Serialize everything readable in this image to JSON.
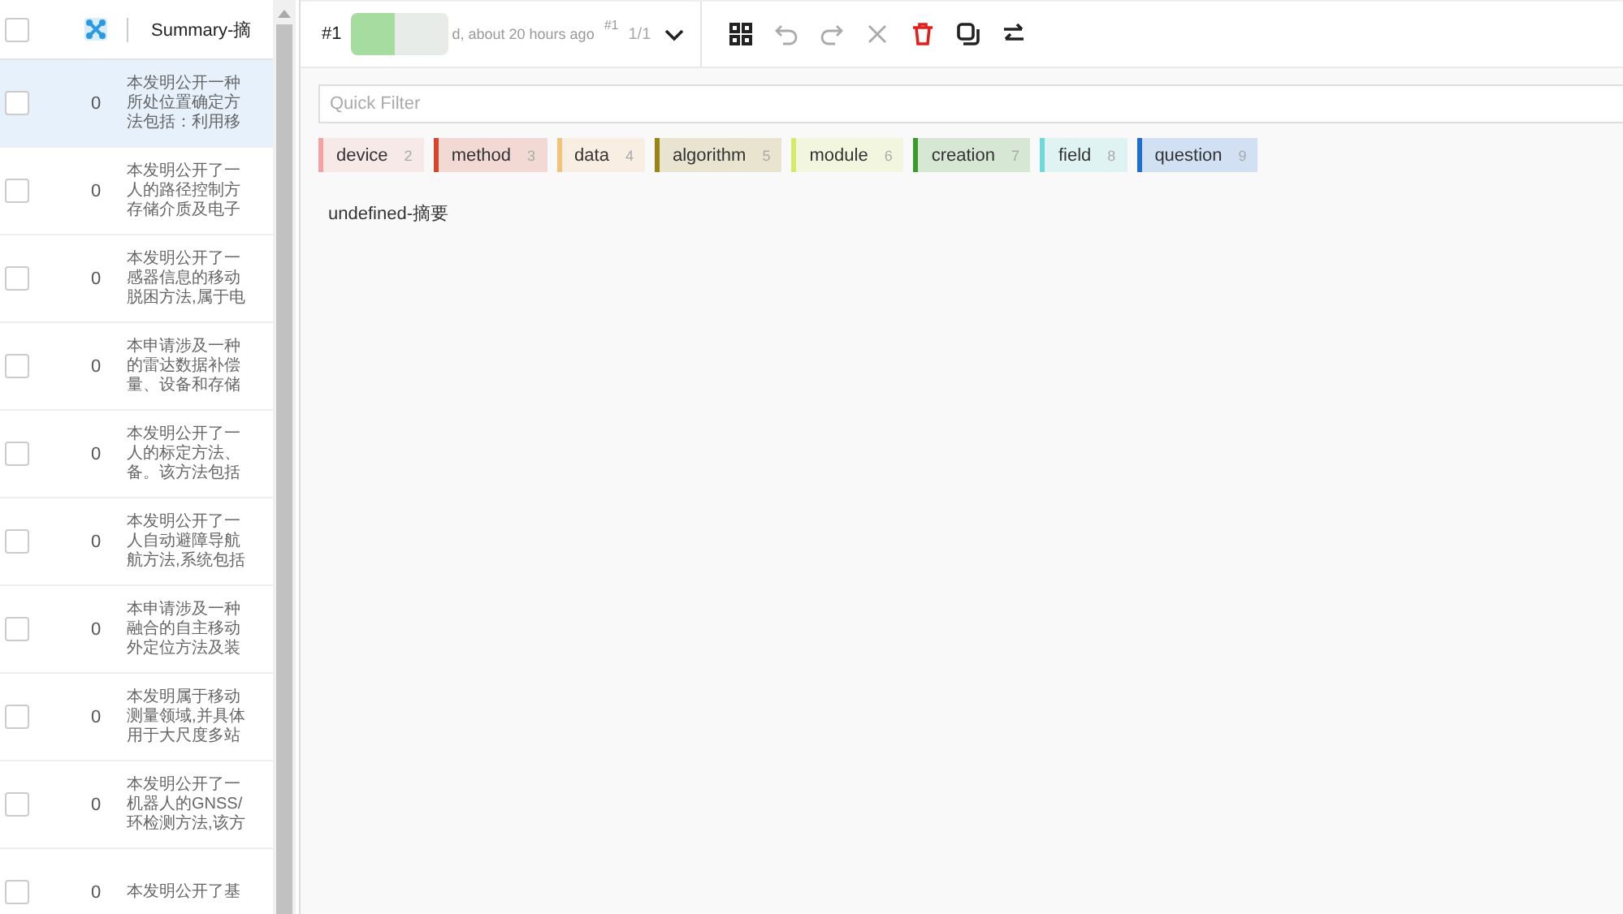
{
  "list": {
    "header": {
      "select_all": {
        "checked": false
      },
      "column_title": "Summary-摘"
    },
    "rows": [
      {
        "selected": true,
        "checked": false,
        "count": "0",
        "summary": [
          "本发明公开一种",
          "所处位置确定方",
          "法包括：利用移"
        ]
      },
      {
        "selected": false,
        "checked": false,
        "count": "0",
        "summary": [
          "本发明公开了一",
          "人的路径控制方",
          "存储介质及电子"
        ]
      },
      {
        "selected": false,
        "checked": false,
        "count": "0",
        "summary": [
          "本发明公开了一",
          "感器信息的移动",
          "脱困方法,属于电"
        ]
      },
      {
        "selected": false,
        "checked": false,
        "count": "0",
        "summary": [
          "本申请涉及一种",
          "的雷达数据补偿",
          "量、设备和存储"
        ]
      },
      {
        "selected": false,
        "checked": false,
        "count": "0",
        "summary": [
          "本发明公开了一",
          "人的标定方法、",
          "备。该方法包括"
        ]
      },
      {
        "selected": false,
        "checked": false,
        "count": "0",
        "summary": [
          "本发明公开了一",
          "人自动避障导航",
          "航方法,系统包括"
        ]
      },
      {
        "selected": false,
        "checked": false,
        "count": "0",
        "summary": [
          "本申请涉及一种",
          "融合的自主移动",
          "外定位方法及装"
        ]
      },
      {
        "selected": false,
        "checked": false,
        "count": "0",
        "summary": [
          "本发明属于移动",
          "测量领域,并具体",
          "用于大尺度多站"
        ]
      },
      {
        "selected": false,
        "checked": false,
        "count": "0",
        "summary": [
          "本发明公开了一",
          "机器人的GNSS/",
          "环检测方法,该方"
        ]
      },
      {
        "selected": false,
        "checked": false,
        "count": "0",
        "summary": [
          "本发明公开了基"
        ]
      }
    ]
  },
  "topbar": {
    "task_id": "#1",
    "annotation_time": "d, about 20 hours ago",
    "annotation_id": "#1",
    "pager": "1/1"
  },
  "toolbar": [
    {
      "kind": "grid",
      "disabled": false
    },
    {
      "kind": "undo",
      "disabled": true
    },
    {
      "kind": "redo",
      "disabled": true
    },
    {
      "kind": "close",
      "disabled": true
    },
    {
      "kind": "trash",
      "disabled": false
    },
    {
      "kind": "copy",
      "disabled": false
    },
    {
      "kind": "swap",
      "disabled": false
    }
  ],
  "filter": {
    "placeholder": "Quick Filter"
  },
  "labels": [
    {
      "label": "device",
      "hotkey": "2",
      "color": "#f4a3a3"
    },
    {
      "label": "method",
      "hotkey": "3",
      "color": "#d4472d"
    },
    {
      "label": "data",
      "hotkey": "4",
      "color": "#f5c27a"
    },
    {
      "label": "algorithm",
      "hotkey": "5",
      "color": "#9a8418"
    },
    {
      "label": "module",
      "hotkey": "6",
      "color": "#d6ea6a"
    },
    {
      "label": "creation",
      "hotkey": "7",
      "color": "#3a9a2a"
    },
    {
      "label": "field",
      "hotkey": "8",
      "color": "#6fd8d8"
    },
    {
      "label": "question",
      "hotkey": "9",
      "color": "#1e6fd0"
    }
  ],
  "content_text": "undefined-摘要"
}
